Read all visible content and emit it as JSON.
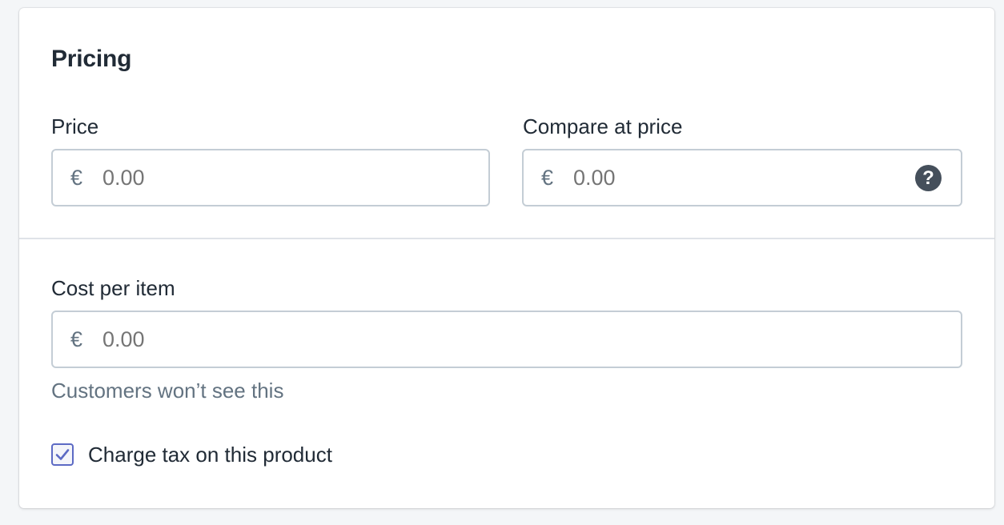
{
  "card": {
    "title": "Pricing"
  },
  "price": {
    "label": "Price",
    "currency": "€",
    "placeholder": "0.00"
  },
  "compare_at_price": {
    "label": "Compare at price",
    "currency": "€",
    "placeholder": "0.00",
    "help_glyph": "?"
  },
  "cost_per_item": {
    "label": "Cost per item",
    "currency": "€",
    "placeholder": "0.00",
    "hint": "Customers won’t see this"
  },
  "charge_tax": {
    "label": "Charge tax on this product",
    "checked": true
  },
  "colors": {
    "accent": "#5c6ac4",
    "text": "#212b36",
    "subdued": "#637381",
    "border": "#c4cdd5"
  }
}
